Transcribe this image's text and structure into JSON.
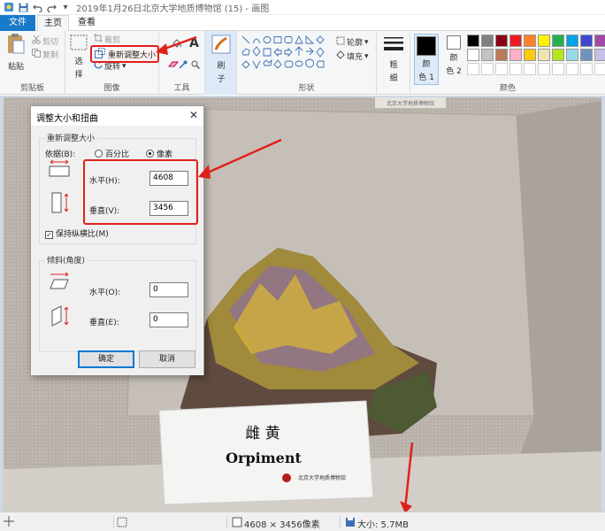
{
  "title": "2019年1月26日北京大学地质博物馆 (15) - 画图",
  "quick_access": {
    "dropdown_glyph": "▾"
  },
  "tabs": {
    "file": "文件",
    "home": "主页",
    "view": "查看"
  },
  "ribbon": {
    "clipboard": {
      "paste": "粘贴",
      "cut": "剪切",
      "copy": "复制",
      "label": "剪贴板"
    },
    "image": {
      "select_1": "选",
      "select_2": "择",
      "crop": "裁剪",
      "resize": "重新调整大小",
      "rotate": "旋转",
      "label": "图像"
    },
    "tools": {
      "text_glyph": "A",
      "label": "工具"
    },
    "brush": {
      "label_1": "刷",
      "label_2": "子"
    },
    "shapes": {
      "outline": "轮廓",
      "fill": "填充",
      "label": "形状"
    },
    "size": {
      "label_1": "粗",
      "label_2": "细"
    },
    "colors": {
      "color1_1": "颜",
      "color1_2": "色 1",
      "color2_1": "颜",
      "color2_2": "色 2",
      "label": "颜色",
      "color1": "#000000",
      "color2": "#ffffff",
      "palette_row1": [
        "#000000",
        "#7f7f7f",
        "#880015",
        "#ed1c24",
        "#ff7f27",
        "#fff200",
        "#22b14c",
        "#00a2e8",
        "#3f48cc",
        "#a349a4"
      ],
      "palette_row2": [
        "#ffffff",
        "#c3c3c3",
        "#b97a57",
        "#ffaec9",
        "#ffc90e",
        "#efe4b0",
        "#b5e61d",
        "#99d9ea",
        "#7092be",
        "#c8bfe7"
      ]
    }
  },
  "dialog": {
    "title": "调整大小和扭曲",
    "close_glyph": "✕",
    "resize_legend": "重新调整大小",
    "by_label": "依据(B):",
    "percent": "百分比",
    "pixels": "像素",
    "horizontal_label": "水平(H):",
    "horizontal_value": "4608",
    "vertical_label": "垂直(V):",
    "vertical_value": "3456",
    "keep_aspect": "保持纵横比(M)",
    "skew_legend": "倾斜(角度)",
    "skew_h_label": "水平(O):",
    "skew_h_value": "0",
    "skew_v_label": "垂直(E):",
    "skew_v_value": "0",
    "ok": "确定",
    "cancel": "取消"
  },
  "photo": {
    "museum_sign": "北京大学地质博物馆",
    "label_cn": "雌 黄",
    "label_en": "Orpiment",
    "label_footer": "北京大学地质博物馆"
  },
  "status": {
    "dimensions": "4608 × 3456像素",
    "size": "大小: 5.7MB"
  }
}
